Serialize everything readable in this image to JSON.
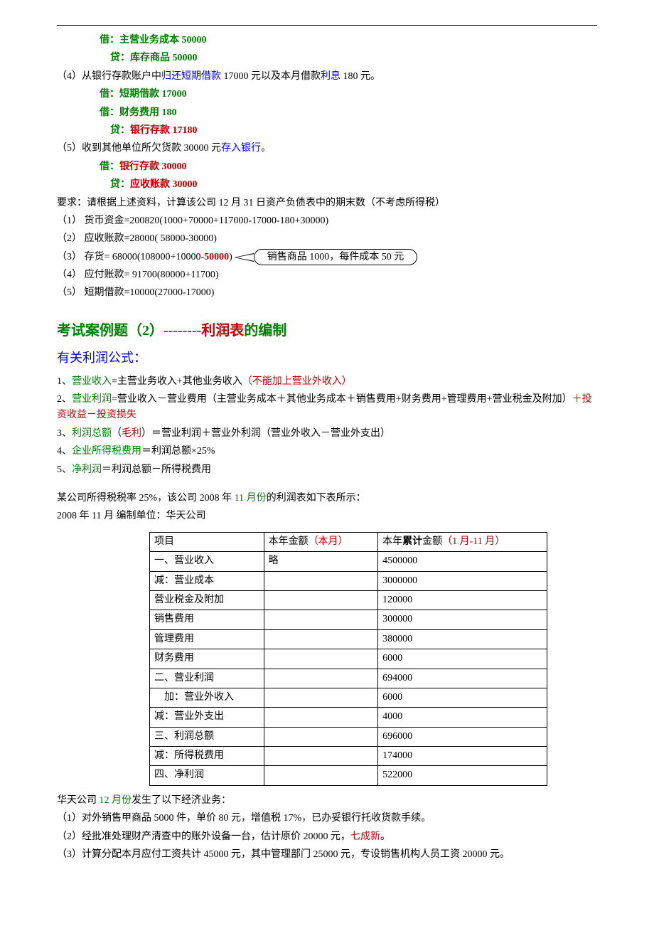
{
  "top": {
    "entry1": "借：主营业务成本  50000",
    "entry2": "贷：库存商品      50000",
    "item4_a": "（4）从银行存款账户中",
    "item4_b": "归还短期借款",
    "item4_c": " 17000 元以及本月借款",
    "item4_d": "利息",
    "item4_e": " 180 元。",
    "entry3": "借：短期借款    17000",
    "entry4": "借：财务费用    180",
    "entry5a": "贷：",
    "entry5b": "银行存款    17180",
    "item5_a": "（5）收到其他单位所欠货款 30000 元",
    "item5_b": "存入银行",
    "item5_c": "。",
    "entry6a": "借：",
    "entry6b": "银行存款    30000",
    "entry7a": "贷：",
    "entry7b": "应收账款    30000",
    "req": "要求：请根据上述资料，计算该公司 12 月 31 日资产负债表中的期末数（不考虑所得税）",
    "calc1": "（1）    货币资金=200820(1000+70000+117000-17000-180+30000)",
    "calc2": "（2）    应收账款=28000( 58000-30000)",
    "calc3a": "（3）    存货= 68000(108000+10000-",
    "calc3b": "50000",
    "calc3c": ")",
    "callout": "销售商品 1000，每件成本 50 元",
    "calc4": "（4）    应付账款= 91700(80000+11700)",
    "calc5": "（5）    短期借款=10000(27000-17000)"
  },
  "title": {
    "a": "考试案例题（2）--------",
    "b": "利润表",
    "c": "的编制"
  },
  "subtitle": "有关利润公式：",
  "formulas": {
    "f1a": "1、",
    "f1b": "营业收入",
    "f1c": "=主营业务收入+其他业务收入",
    "f1d": "（不能加上营业外收入）",
    "f2a": "2、",
    "f2b": "营业利润",
    "f2c": "=营业收入－营业费用（主营业务成本＋其他业务成本＋销售费用+财务费用+管理费用+营业税金及附加）",
    "f2d": "＋投资收益－投资损失",
    "f3a": "3、",
    "f3b": "利润总额",
    "f3c": "（",
    "f3d": "毛利",
    "f3e": "）＝营业利润＋营业外利润（营业外收入－营业外支出）",
    "f4a": "4、",
    "f4b": "企业所得税费用",
    "f4c": "＝利润总额×25%",
    "f5a": "5、",
    "f5b": "净利润",
    "f5c": "＝利润总额－所得税费用"
  },
  "intro": {
    "p1a": "某公司所得税税率 25%，该公司 2008 年 ",
    "p1b": "11 月份",
    "p1c": "的利润表如下表所示：",
    "p2": "2008 年 11 月     编制单位：华天公司"
  },
  "table": {
    "h1": "项目",
    "h2a": "本年金额",
    "h2b": "（本月）",
    "h3a": "本年",
    "h3b": "累计",
    "h3c": "金额",
    "h3d": "（1 月-11 月）",
    "rows": [
      {
        "c1": "一、营业收入",
        "c2": "略",
        "c3": "4500000"
      },
      {
        "c1": "减：营业成本",
        "c2": "",
        "c3": "3000000"
      },
      {
        "c1": "营业税金及附加",
        "c2": "",
        "c3": "120000"
      },
      {
        "c1": "销售费用",
        "c2": "",
        "c3": "300000"
      },
      {
        "c1": "管理费用",
        "c2": "",
        "c3": "380000"
      },
      {
        "c1": "财务费用",
        "c2": "",
        "c3": "6000"
      },
      {
        "c1": "二、营业利润",
        "c2": "",
        "c3": "694000"
      },
      {
        "c1": "    加：营业外收入",
        "c2": "",
        "c3": "6000"
      },
      {
        "c1": "减：营业外支出",
        "c2": "",
        "c3": "4000"
      },
      {
        "c1": "三、利润总额",
        "c2": "",
        "c3": "696000"
      },
      {
        "c1": "减：所得税费用",
        "c2": "",
        "c3": "174000"
      },
      {
        "c1": "四、净利润",
        "c2": "",
        "c3": "522000"
      }
    ]
  },
  "bottom": {
    "l1a": "华天公司 ",
    "l1b": "12 月份",
    "l1c": "发生了以下经济业务：",
    "l2": "（1）对外销售甲商品 5000 件，单价 80 元，增值税 17%，已办妥银行托收货款手续。",
    "l3a": "（2）经批准处理财产清查中的账外设备一台，估计原价 20000 元，",
    "l3b": "七成新",
    "l3c": "。",
    "l4": "（3）计算分配本月应付工资共计 45000 元，其中管理部门 25000 元，专设销售机构人员工资 20000 元。"
  }
}
